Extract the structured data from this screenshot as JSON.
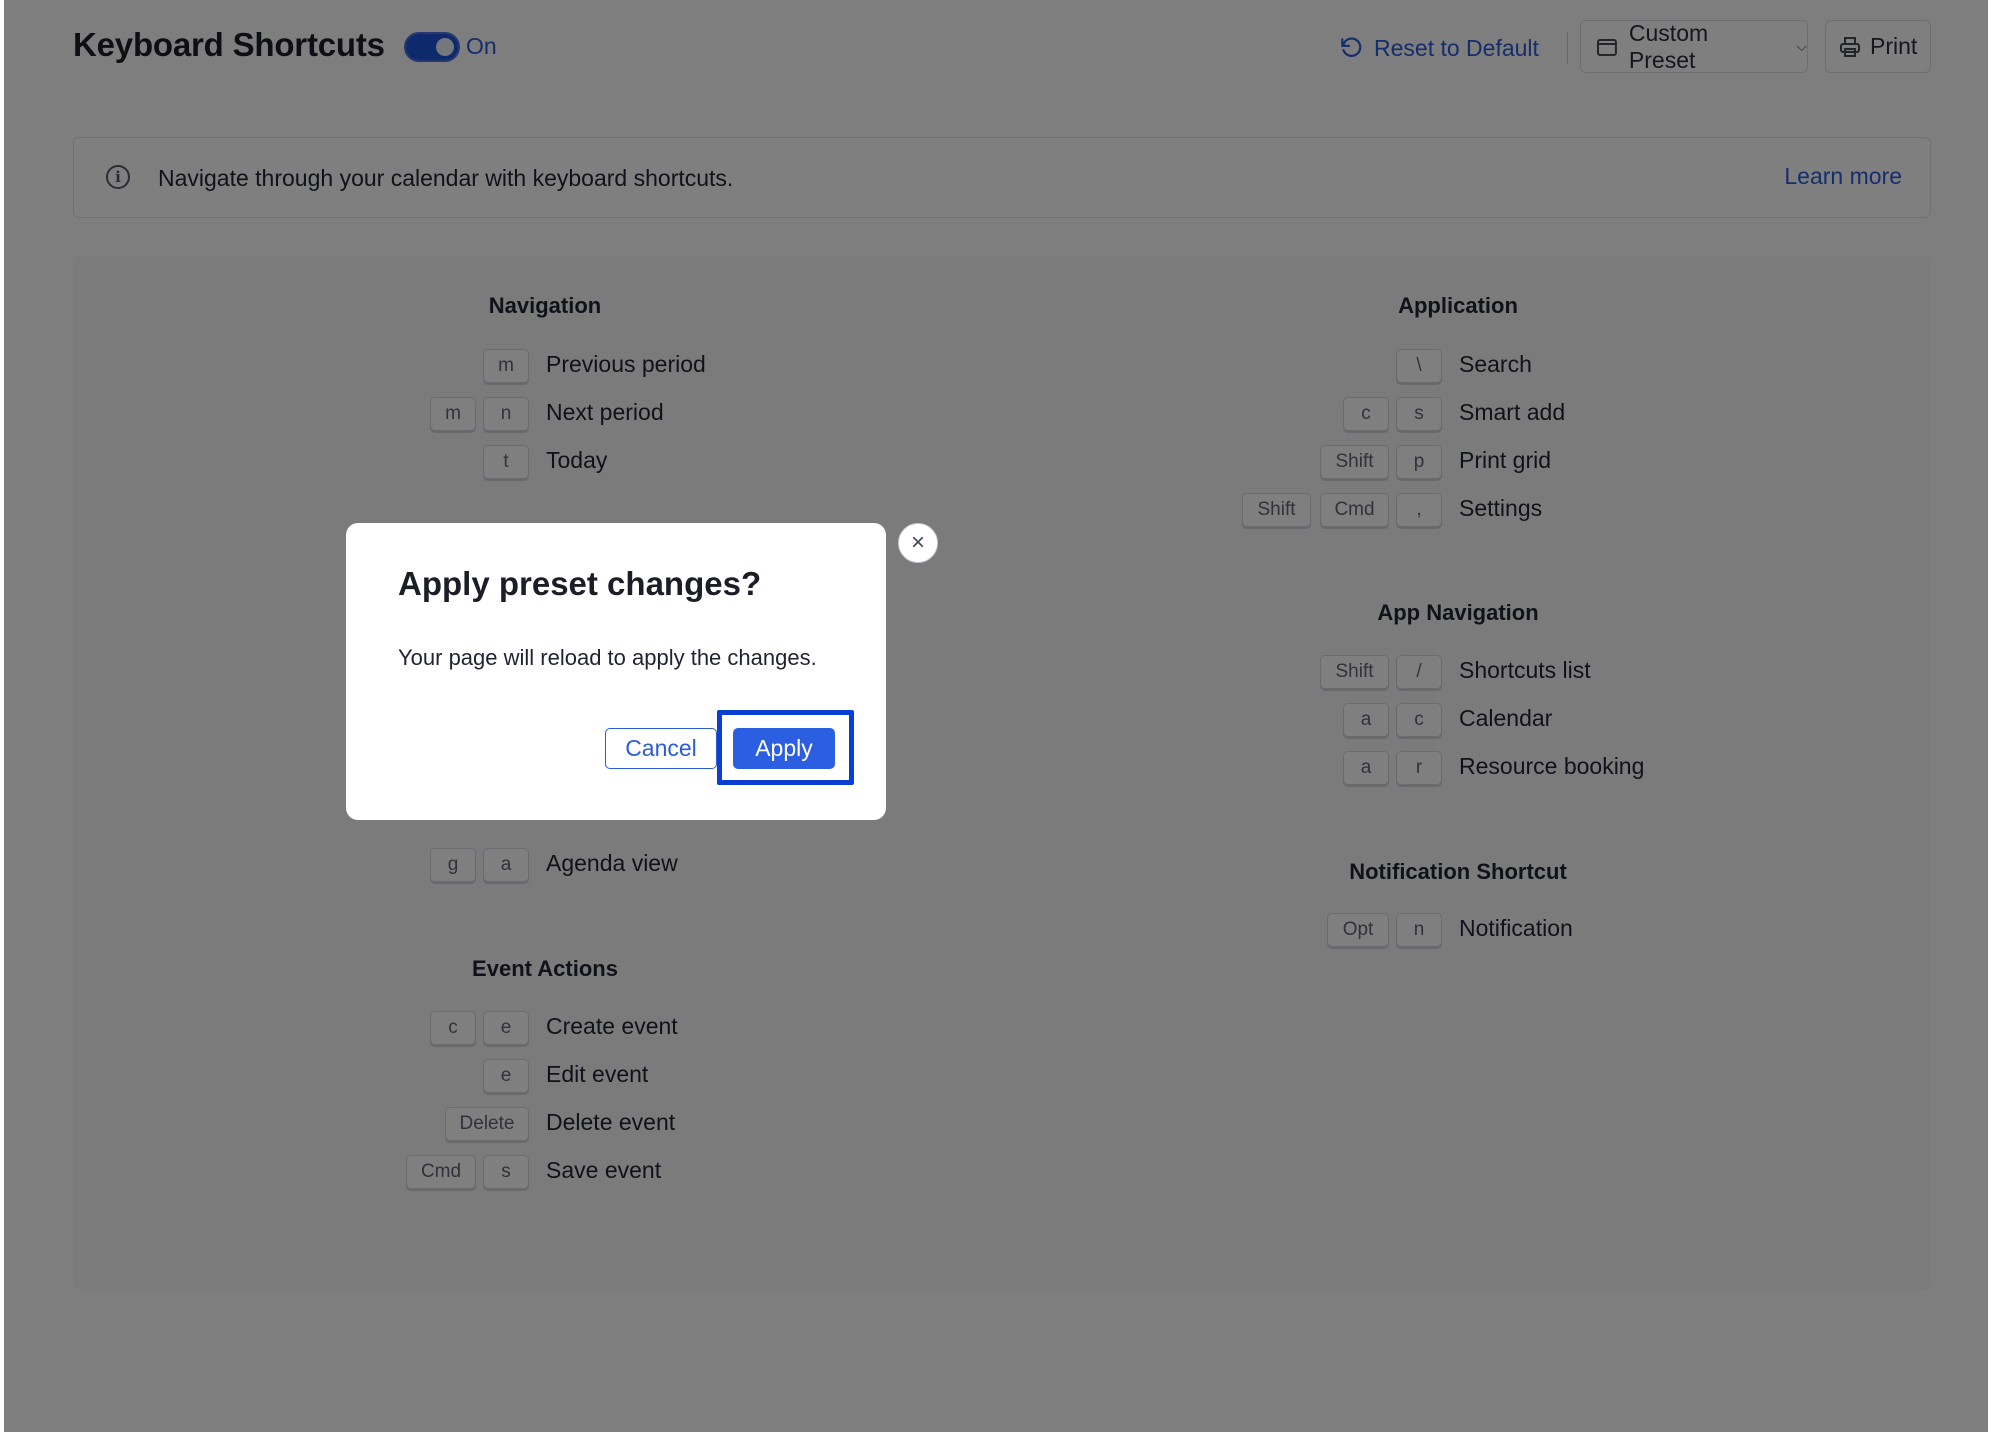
{
  "header": {
    "title": "Keyboard Shortcuts",
    "toggle_label": "On",
    "reset_label": "Reset to Default",
    "preset_label": "Custom Preset",
    "print_label": "Print"
  },
  "banner": {
    "text": "Navigate through your calendar with keyboard shortcuts.",
    "link": "Learn more"
  },
  "sections": {
    "navigation": {
      "title": "Navigation",
      "rows": [
        {
          "keys": [
            "m"
          ],
          "label": "Previous period"
        },
        {
          "keys": [
            "m",
            "n"
          ],
          "label": "Next period"
        },
        {
          "keys": [
            "t"
          ],
          "label": "Today"
        }
      ]
    },
    "views": {
      "rows": [
        {
          "keys": [
            "g",
            "a"
          ],
          "label": "Agenda view"
        }
      ]
    },
    "event_actions": {
      "title": "Event Actions",
      "rows": [
        {
          "keys": [
            "c",
            "e"
          ],
          "label": "Create event"
        },
        {
          "keys": [
            "e"
          ],
          "label": "Edit event"
        },
        {
          "keys": [
            "Delete"
          ],
          "label": "Delete event"
        },
        {
          "keys": [
            "Cmd",
            "s"
          ],
          "label": "Save event"
        }
      ]
    },
    "application": {
      "title": "Application",
      "rows": [
        {
          "keys": [
            "\\"
          ],
          "label": "Search"
        },
        {
          "keys": [
            "c",
            "s"
          ],
          "label": "Smart add"
        },
        {
          "keys": [
            "Shift",
            "p"
          ],
          "label": "Print grid"
        },
        {
          "keys": [
            "Shift",
            "Cmd",
            ","
          ],
          "label": "Settings"
        }
      ]
    },
    "app_navigation": {
      "title": "App Navigation",
      "rows": [
        {
          "keys": [
            "Shift",
            "/"
          ],
          "label": "Shortcuts list"
        },
        {
          "keys": [
            "a",
            "c"
          ],
          "label": "Calendar"
        },
        {
          "keys": [
            "a",
            "r"
          ],
          "label": "Resource booking"
        }
      ]
    },
    "notification": {
      "title": "Notification Shortcut",
      "rows": [
        {
          "keys": [
            "Opt",
            "n"
          ],
          "label": "Notification"
        }
      ]
    }
  },
  "modal": {
    "title": "Apply preset changes?",
    "body": "Your page will reload to apply the changes.",
    "cancel_label": "Cancel",
    "apply_label": "Apply",
    "close_glyph": "×"
  },
  "colors": {
    "accent": "#2b5ee0",
    "highlight": "#0b3fd1"
  }
}
